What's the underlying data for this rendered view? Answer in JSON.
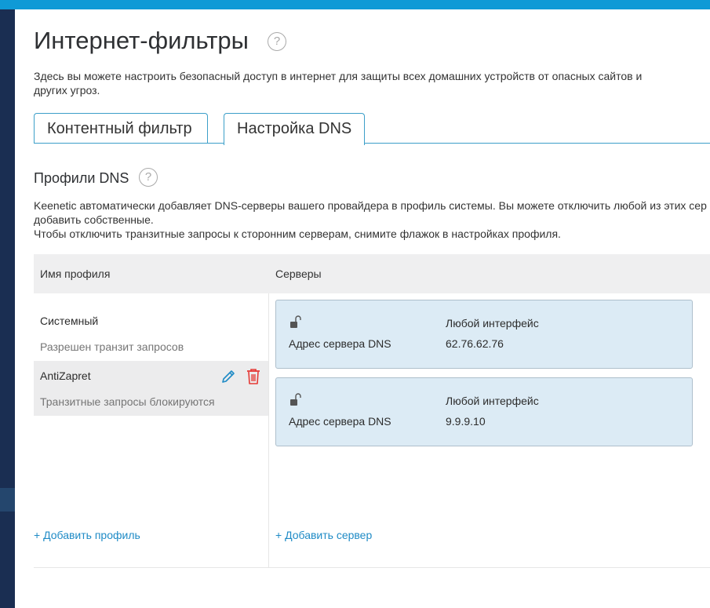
{
  "page": {
    "title": "Интернет-фильтры",
    "description": "Здесь вы можете настроить безопасный доступ в интернет для защиты всех домашних устройств от опасных сайтов и других угроз."
  },
  "tabs": [
    {
      "label": "Контентный фильтр",
      "active": false
    },
    {
      "label": "Настройка DNS",
      "active": true
    }
  ],
  "section": {
    "title": "Профили DNS",
    "desc_line1": "Keenetic автоматически добавляет DNS-серверы вашего провайдера в профиль системы. Вы можете отключить любой из этих сер",
    "desc_line2": "добавить собственные.",
    "desc_line3": "Чтобы отключить транзитные запросы к сторонним серверам, снимите флажок в настройках профиля."
  },
  "table": {
    "col_name": "Имя профиля",
    "col_servers": "Серверы"
  },
  "profiles": [
    {
      "name": "Системный",
      "status": "Разрешен транзит запросов"
    },
    {
      "name": "AntiZapret",
      "status": "Транзитные запросы блокируются"
    }
  ],
  "servers": [
    {
      "interface": "Любой интерфейс",
      "label": "Адрес сервера DNS",
      "address": "62.76.62.76"
    },
    {
      "interface": "Любой интерфейс",
      "label": "Адрес сервера DNS",
      "address": "9.9.9.10"
    }
  ],
  "actions": {
    "add_profile": "+ Добавить профиль",
    "add_server": "+ Добавить сервер"
  },
  "colors": {
    "accent": "#0f9ad6",
    "sidebar": "#1a2e52",
    "link": "#1f8bc6",
    "delete": "#e53935",
    "card_bg": "#dcebf5"
  },
  "icons": {
    "help": "question-circle",
    "edit": "pencil",
    "delete": "trash-can",
    "lock": "open-padlock"
  }
}
